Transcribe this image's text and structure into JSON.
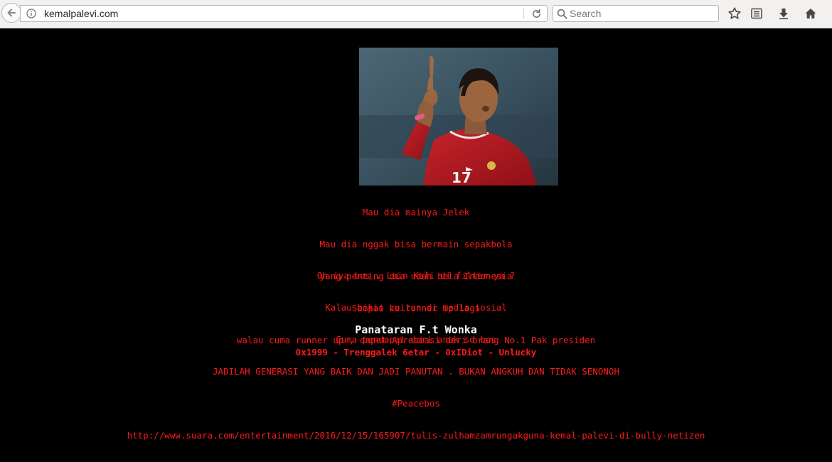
{
  "browser": {
    "url": "kemalpalevi.com",
    "search_placeholder": "Search"
  },
  "page": {
    "photo_alt": "",
    "paragraph1": [
      "Mau dia mainya Jelek",
      "Mau dia nggak bisa bermain sepakbola",
      "yang penting dia udah bela Indonesia",
      "Sampai ke runner Up lagi",
      "walau cuma runner up , dapet Apresiasi dari orang No.1 Pak presiden"
    ],
    "paragraph2": [
      "Oh iya bos . Lain Kali di filter ya ?",
      "Kalau bikin cuitan di media sosial",
      "Cuma pendapat dari anak sd bos",
      "JADILAH GENERASI YANG BAIK DAN JADI PANUTAN . BUKAN ANGKUH DAN TIDAK SENONOH",
      "#Peacebos",
      "http://www.suara.com/entertainment/2016/12/15/165907/tulis-zulhamzamrungakguna-kemal-palevi-di-bully-netizen"
    ],
    "team": "Panataran F.t Wonka",
    "greets": "0x1999 - Trenggalek 6etar - 0xIDiot - Unlucky"
  },
  "colors": {
    "text_red": "#ff1a1a",
    "background": "#000000"
  }
}
